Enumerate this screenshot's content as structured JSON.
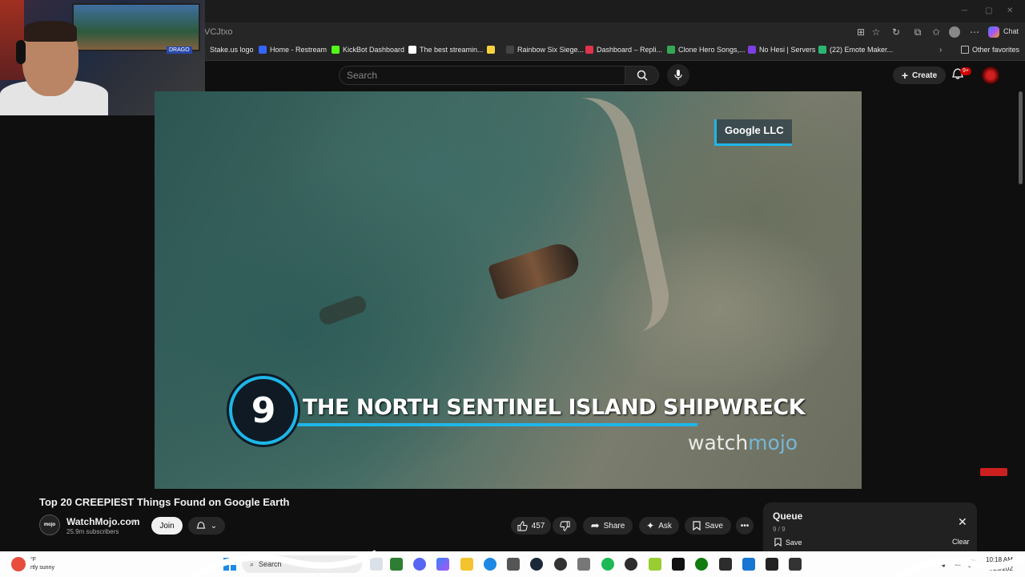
{
  "browser": {
    "url_fragment": "VCJtxo",
    "chat_label": "Chat",
    "bookmarks": [
      {
        "label": "Stake.us logo",
        "color": "#1f2a33"
      },
      {
        "label": "Home - Restream",
        "color": "#3366ff"
      },
      {
        "label": "KickBot Dashboard",
        "color": "#53fc18"
      },
      {
        "label": "The best streamin...",
        "color": "#ffffff"
      },
      {
        "label": "",
        "color": "#f7d23e"
      },
      {
        "label": "Rainbow Six Siege...",
        "color": "#444444"
      },
      {
        "label": "Dashboard – Repli...",
        "color": "#e0334a"
      },
      {
        "label": "Clone Hero Songs,...",
        "color": "#34a853"
      },
      {
        "label": "No Hesi | Servers",
        "color": "#7b3fe4"
      },
      {
        "label": "(22) Emote Maker...",
        "color": "#2bb673"
      }
    ],
    "other_favorites": "Other favorites"
  },
  "webcam": {
    "overlay_logo": "DRAGO"
  },
  "header": {
    "search_placeholder": "Search",
    "create_label": "Create",
    "notif_badge": "9+"
  },
  "video": {
    "watermark_label": "Google LLC",
    "rank": "9",
    "entry_title": "THE NORTH SENTINEL ISLAND SHIPWRECK",
    "brand_watch": "watch",
    "brand_mojo": "mojo"
  },
  "info": {
    "title": "Top 20 CREEPIEST Things Found on Google Earth",
    "channel_name": "WatchMojo.com",
    "channel_avatar_text": "mojo",
    "subscribers": "25.9m subscribers",
    "join_label": "Join",
    "likes": "457",
    "share_label": "Share",
    "ask_label": "Ask",
    "save_label": "Save"
  },
  "queue": {
    "title": "Queue",
    "count": "9 / 9",
    "save_label": "Save",
    "clear_label": "Clear"
  },
  "taskbar": {
    "weather_temp": "°F",
    "weather_desc": "rtly sunny",
    "search_label": "Search",
    "time": "10:18 AM",
    "date": "4/26/202"
  },
  "colors": {
    "accent": "#1eb6e8",
    "youtube_red": "#cc0000",
    "bg": "#0f0f0f"
  }
}
